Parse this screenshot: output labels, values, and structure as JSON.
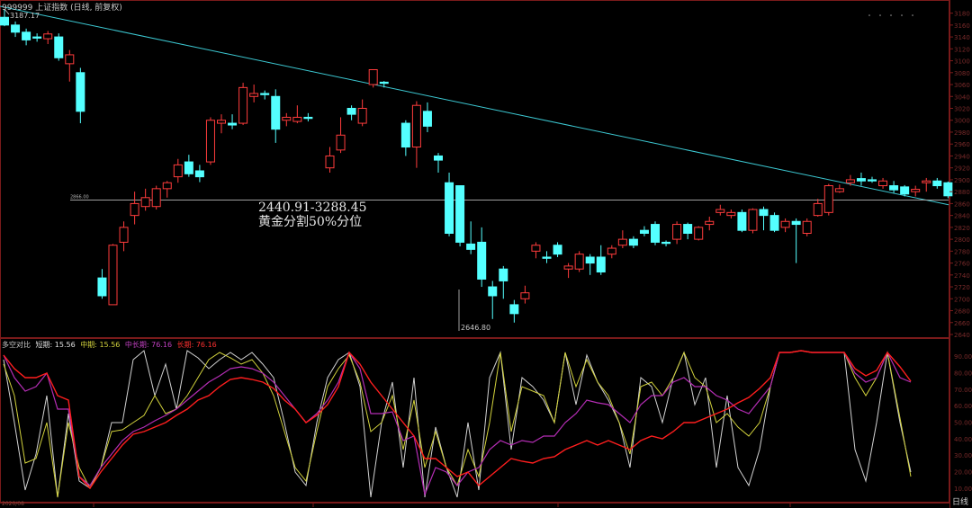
{
  "header": {
    "title": "999999 上证指数 (日线, 前复权)"
  },
  "main_chart": {
    "high_label": "3187.17",
    "low_label": "2646.80",
    "level_label": "2866.00",
    "annotation_range": "2440.91-3288.45",
    "annotation_text": "黄金分割50%分位",
    "y_ticks": [
      "3180",
      "3160",
      "3140",
      "3120",
      "3100",
      "3080",
      "3060",
      "3040",
      "3020",
      "3000",
      "2980",
      "2960",
      "2940",
      "2920",
      "2900",
      "2880",
      "2860",
      "2840",
      "2820",
      "2800",
      "2780",
      "2760",
      "2740",
      "2720",
      "2700",
      "2680",
      "2660",
      "2640"
    ],
    "colors": {
      "up": "#ff3c3c",
      "down": "#54ffff",
      "trendline": "#3cc8d2",
      "level": "#b4b4b4"
    }
  },
  "indicator": {
    "name": "多空对比",
    "short_label": "短期: 15.56",
    "mid_label": "中期: 15.56",
    "midlong_label": "中长期: 76.16",
    "long_label": "长期: 76.16",
    "colors": {
      "short": "#d2d2d2",
      "mid": "#d2d23c",
      "midlong": "#b42db4",
      "long": "#ff1e1e"
    },
    "y_ticks": [
      "90.00",
      "80.00",
      "70.00",
      "60.00",
      "50.00",
      "40.00",
      "30.00",
      "20.00",
      "10.00"
    ]
  },
  "footer": {
    "period": "日线",
    "date_left": "2020/08"
  },
  "chart_data": {
    "type": "candlestick",
    "title": "999999 上证指数 (日线, 前复权)",
    "y_range": [
      2640,
      3190
    ],
    "candles": [
      {
        "o": 3173,
        "c": 3160,
        "h": 3187,
        "l": 3158
      },
      {
        "o": 3160,
        "c": 3148,
        "h": 3166,
        "l": 3140
      },
      {
        "o": 3148,
        "c": 3135,
        "h": 3154,
        "l": 3126
      },
      {
        "o": 3140,
        "c": 3138,
        "h": 3146,
        "l": 3132
      },
      {
        "o": 3137,
        "c": 3145,
        "h": 3150,
        "l": 3128
      },
      {
        "o": 3140,
        "c": 3105,
        "h": 3146,
        "l": 3100
      },
      {
        "o": 3095,
        "c": 3110,
        "h": 3118,
        "l": 3065
      },
      {
        "o": 3080,
        "c": 3015,
        "h": 3088,
        "l": 2995
      },
      {
        "o": null,
        "c": null,
        "h": null,
        "l": null
      },
      {
        "o": 2735,
        "c": 2705,
        "h": 2750,
        "l": 2700
      },
      {
        "o": 2690,
        "c": 2790,
        "h": 2792,
        "l": 2690
      },
      {
        "o": 2795,
        "c": 2820,
        "h": 2830,
        "l": 2780
      },
      {
        "o": 2840,
        "c": 2860,
        "h": 2880,
        "l": 2825
      },
      {
        "o": 2855,
        "c": 2870,
        "h": 2885,
        "l": 2848
      },
      {
        "o": 2855,
        "c": 2885,
        "h": 2890,
        "l": 2850
      },
      {
        "o": 2885,
        "c": 2895,
        "h": 2898,
        "l": 2870
      },
      {
        "o": 2905,
        "c": 2925,
        "h": 2935,
        "l": 2895
      },
      {
        "o": 2930,
        "c": 2910,
        "h": 2942,
        "l": 2905
      },
      {
        "o": 2915,
        "c": 2905,
        "h": 2925,
        "l": 2896
      },
      {
        "o": 2930,
        "c": 3000,
        "h": 3005,
        "l": 2925
      },
      {
        "o": 2995,
        "c": 3000,
        "h": 3010,
        "l": 2978
      },
      {
        "o": 2995,
        "c": 2992,
        "h": 3010,
        "l": 2985
      },
      {
        "o": 2995,
        "c": 3055,
        "h": 3063,
        "l": 2992
      },
      {
        "o": 3040,
        "c": 3045,
        "h": 3060,
        "l": 3030
      },
      {
        "o": 3045,
        "c": 3043,
        "h": 3050,
        "l": 3035
      },
      {
        "o": 3040,
        "c": 2985,
        "h": 3052,
        "l": 2962
      },
      {
        "o": 3000,
        "c": 3005,
        "h": 3012,
        "l": 2990
      },
      {
        "o": 2998,
        "c": 3005,
        "h": 3025,
        "l": 2995
      },
      {
        "o": 3005,
        "c": 3003,
        "h": 3012,
        "l": 2998
      },
      {
        "o": null,
        "c": null,
        "h": null,
        "l": null
      },
      {
        "o": 2920,
        "c": 2940,
        "h": 2955,
        "l": 2912
      },
      {
        "o": 2950,
        "c": 2975,
        "h": 3005,
        "l": 2945
      },
      {
        "o": 3020,
        "c": 3010,
        "h": 3025,
        "l": 3000
      },
      {
        "o": 2995,
        "c": 3020,
        "h": 3035,
        "l": 2990
      },
      {
        "o": 3060,
        "c": 3085,
        "h": 3085,
        "l": 3055
      },
      {
        "o": 3064,
        "c": 3062,
        "h": 3066,
        "l": 3055
      },
      {
        "o": null,
        "c": null,
        "h": null,
        "l": null
      },
      {
        "o": 2995,
        "c": 2955,
        "h": 3000,
        "l": 2940
      },
      {
        "o": 2955,
        "c": 3025,
        "h": 3032,
        "l": 2920
      },
      {
        "o": 3015,
        "c": 2990,
        "h": 3030,
        "l": 2980
      },
      {
        "o": 2940,
        "c": 2933,
        "h": 2945,
        "l": 2912
      },
      {
        "o": 2895,
        "c": 2810,
        "h": 2912,
        "l": 2805
      },
      {
        "o": 2890,
        "c": 2795,
        "h": 2890,
        "l": 2788
      },
      {
        "o": 2792,
        "c": 2783,
        "h": 2830,
        "l": 2775
      },
      {
        "o": 2795,
        "c": 2733,
        "h": 2820,
        "l": 2720
      },
      {
        "o": 2720,
        "c": 2705,
        "h": 2730,
        "l": 2666
      },
      {
        "o": 2750,
        "c": 2730,
        "h": 2755,
        "l": 2700
      },
      {
        "o": 2690,
        "c": 2675,
        "h": 2698,
        "l": 2660
      },
      {
        "o": 2700,
        "c": 2710,
        "h": 2722,
        "l": 2692
      },
      {
        "o": 2780,
        "c": 2790,
        "h": 2795,
        "l": 2768
      },
      {
        "o": 2770,
        "c": 2768,
        "h": 2780,
        "l": 2760
      },
      {
        "o": 2790,
        "c": 2775,
        "h": 2795,
        "l": 2770
      },
      {
        "o": 2750,
        "c": 2755,
        "h": 2760,
        "l": 2735
      },
      {
        "o": 2750,
        "c": 2775,
        "h": 2780,
        "l": 2745
      },
      {
        "o": 2770,
        "c": 2760,
        "h": 2775,
        "l": 2740
      },
      {
        "o": 2770,
        "c": 2745,
        "h": 2790,
        "l": 2740
      },
      {
        "o": 2775,
        "c": 2785,
        "h": 2790,
        "l": 2768
      },
      {
        "o": 2790,
        "c": 2800,
        "h": 2815,
        "l": 2785
      },
      {
        "o": 2800,
        "c": 2790,
        "h": 2805,
        "l": 2785
      },
      {
        "o": 2815,
        "c": 2810,
        "h": 2822,
        "l": 2805
      },
      {
        "o": 2825,
        "c": 2795,
        "h": 2830,
        "l": 2790
      },
      {
        "o": 2795,
        "c": 2793,
        "h": 2798,
        "l": 2788
      },
      {
        "o": 2800,
        "c": 2825,
        "h": 2830,
        "l": 2792
      },
      {
        "o": 2825,
        "c": 2810,
        "h": 2828,
        "l": 2800
      },
      {
        "o": 2800,
        "c": 2820,
        "h": 2822,
        "l": 2798
      },
      {
        "o": 2825,
        "c": 2830,
        "h": 2838,
        "l": 2815
      },
      {
        "o": 2845,
        "c": 2850,
        "h": 2858,
        "l": 2840
      },
      {
        "o": 2840,
        "c": 2845,
        "h": 2850,
        "l": 2835
      },
      {
        "o": 2845,
        "c": 2815,
        "h": 2850,
        "l": 2812
      },
      {
        "o": 2815,
        "c": 2850,
        "h": 2852,
        "l": 2810
      },
      {
        "o": 2850,
        "c": 2840,
        "h": 2855,
        "l": 2815
      },
      {
        "o": 2840,
        "c": 2815,
        "h": 2845,
        "l": 2812
      },
      {
        "o": 2820,
        "c": 2830,
        "h": 2835,
        "l": 2812
      },
      {
        "o": 2830,
        "c": 2825,
        "h": 2835,
        "l": 2760
      },
      {
        "o": 2810,
        "c": 2830,
        "h": 2835,
        "l": 2805
      },
      {
        "o": 2840,
        "c": 2860,
        "h": 2868,
        "l": 2838
      },
      {
        "o": 2845,
        "c": 2890,
        "h": 2893,
        "l": 2840
      },
      {
        "o": 2880,
        "c": 2885,
        "h": 2892,
        "l": 2878
      },
      {
        "o": 2895,
        "c": 2900,
        "h": 2908,
        "l": 2890
      },
      {
        "o": 2902,
        "c": 2898,
        "h": 2912,
        "l": 2890
      },
      {
        "o": 2900,
        "c": 2898,
        "h": 2905,
        "l": 2895
      },
      {
        "o": 2890,
        "c": 2898,
        "h": 2903,
        "l": 2885
      },
      {
        "o": 2890,
        "c": 2883,
        "h": 2898,
        "l": 2878
      },
      {
        "o": 2888,
        "c": 2876,
        "h": 2891,
        "l": 2872
      },
      {
        "o": 2880,
        "c": 2884,
        "h": 2890,
        "l": 2872
      },
      {
        "o": 2895,
        "c": 2898,
        "h": 2903,
        "l": 2880
      },
      {
        "o": 2898,
        "c": 2890,
        "h": 2903,
        "l": 2885
      },
      {
        "o": 2895,
        "c": 2873,
        "h": 2897,
        "l": 2869
      }
    ],
    "trendline": [
      {
        "i": 0,
        "v": 3190
      },
      {
        "i": 86,
        "v": 2862
      }
    ],
    "horizontal_level": 2866
  }
}
